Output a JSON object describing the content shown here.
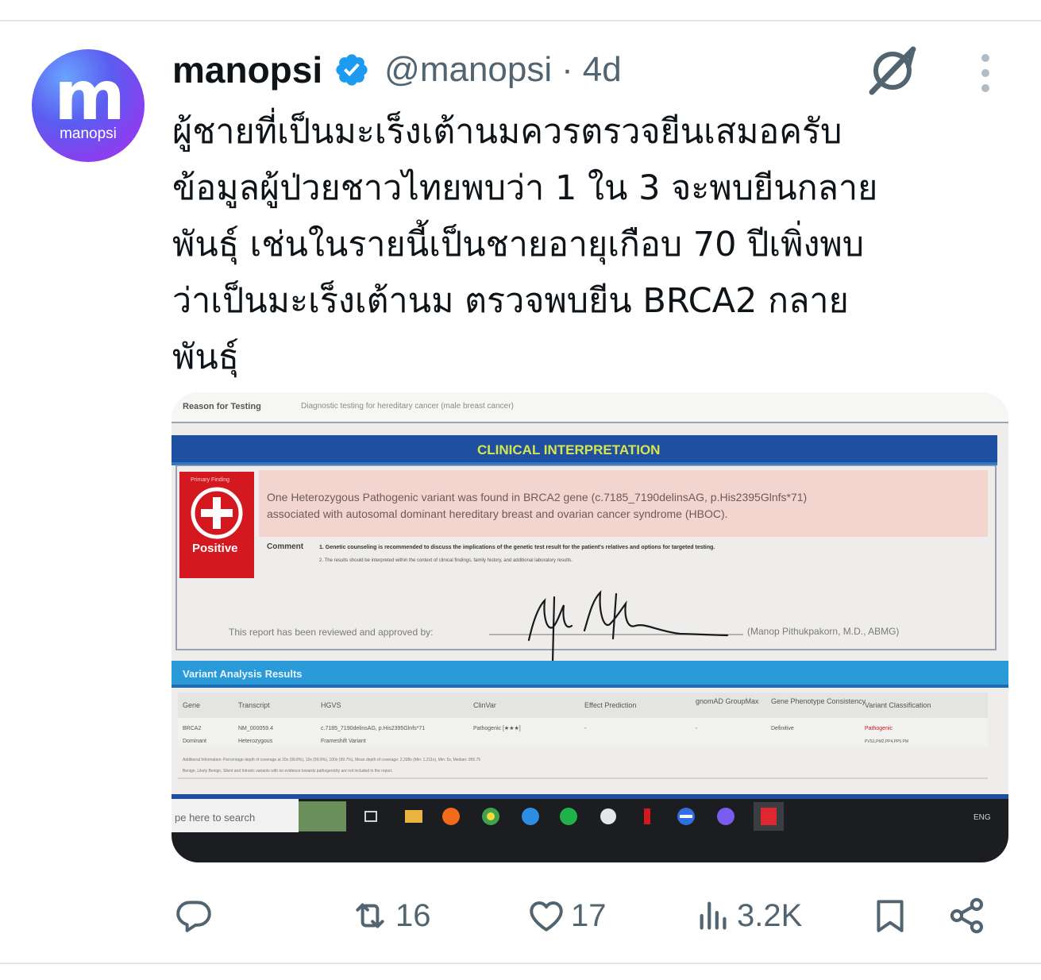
{
  "author": {
    "avatar_letter": "m",
    "avatar_sub": "manopsi",
    "name": "manopsi",
    "handle": "@manopsi",
    "separator": "·",
    "time": "4d"
  },
  "icons": {
    "verified": "verified-badge-icon",
    "grok": "grok-icon",
    "more": "more-vertical-icon",
    "reply": "reply-icon",
    "retweet": "retweet-icon",
    "like": "heart-icon",
    "views": "views-bar-icon",
    "bookmark": "bookmark-icon",
    "share": "share-icon"
  },
  "colors": {
    "verified": "#1d9bf0",
    "text": "#0f1419",
    "muted": "#536471",
    "report_blue": "#1e4fa0",
    "report_red": "#d4181f",
    "report_pink": "#f3d5d0"
  },
  "tweet": {
    "lines": [
      "ผู้ชายที่เป็นมะเร็งเต้านมควรตรวจยีนเสมอครับ",
      "ข้อมูลผู้ป่วยชาวไทยพบว่า 1 ใน 3 จะพบยีนกลาย",
      "พันธุ์ เช่นในรายนี้เป็นชายอายุเกือบ 70 ปีเพิ่งพบ",
      "ว่าเป็นมะเร็งเต้านม ตรวจพบยีน BRCA2 กลาย",
      "พันธุ์"
    ]
  },
  "report": {
    "reason_label": "Reason for Testing",
    "reason_value": "Diagnostic testing for hereditary cancer (male breast cancer)",
    "section_title": "CLINICAL INTERPRETATION",
    "badge_top": "Primary Finding",
    "badge_label": "Positive",
    "finding_line1": "One Heterozygous Pathogenic variant was found in BRCA2 gene (c.7185_7190delinsAG, p.His2395Glnfs*71)",
    "finding_line2": "associated with autosomal dominant hereditary breast and ovarian cancer syndrome (HBOC).",
    "comment_label": "Comment",
    "comment_1": "1. Genetic counseling is recommended to discuss the implications of the genetic test result for the patient's relatives and options for targeted testing.",
    "comment_2": "2. The results should be interpreted within the context of clinical findings, family history, and additional laboratory results.",
    "approval_text": "This report has been reviewed and approved by:",
    "approver": "(Manop Pithukpakorn, M.D., ABMG)",
    "variant_header": "Variant Analysis Results",
    "columns": [
      "Gene",
      "Transcript",
      "HGVS",
      "ClinVar",
      "Effect Prediction",
      "gnomAD GroupMax",
      "Gene Phenotype Consistency",
      "Variant Classification"
    ],
    "row1": [
      "BRCA2",
      "NM_000059.4",
      "c.7185_7190delinsAG, p.His2395Glnfs*71",
      "Pathogenic [★★★]",
      "-",
      "-",
      "Definitive",
      "Pathogenic"
    ],
    "row2": [
      "Dominant",
      "Heterozygous",
      "Frameshift Variant",
      "",
      "",
      "",
      "",
      "PVS1,PM2,PP4,PP5 PM"
    ],
    "footnote1": "Additional Information: Percentage depth of coverage at 20x (99.8%), 10x (99.9%), 100x (99.7%), Mean depth of coverage: 2,338x (Min: 1,211x), Min: 5x, Median: 955.75",
    "footnote2": "Benign, Likely Benign, Silent and Intronic variants with no evidence towards pathogenicity are not included in the report.",
    "taskbar_search": "pe here to search",
    "taskbar_lang": "ENG"
  },
  "stats": {
    "retweets": "16",
    "likes": "17",
    "views": "3.2K"
  }
}
